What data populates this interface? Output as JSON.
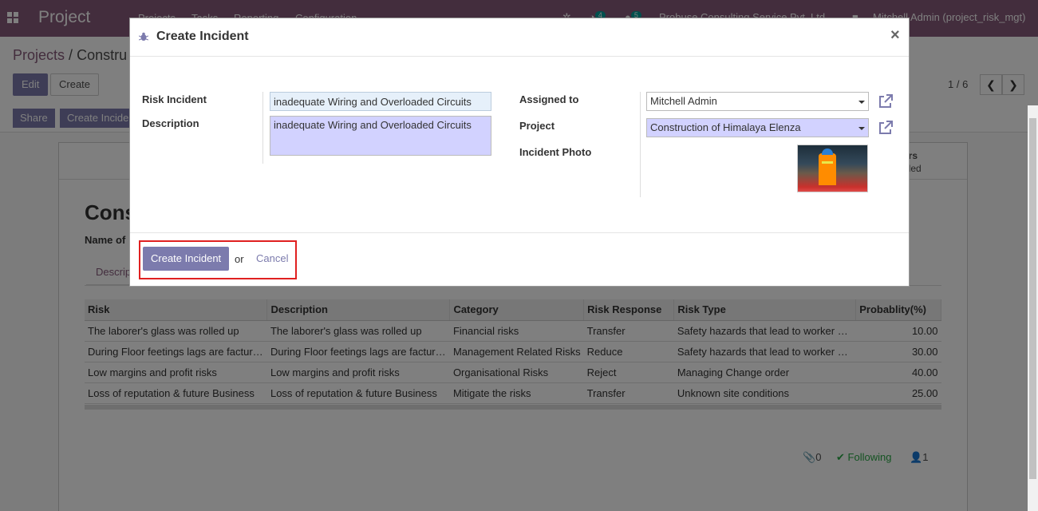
{
  "navbar": {
    "brand": "Project",
    "menu": [
      "Projects",
      "Tasks",
      "Reporting",
      "Configuration"
    ],
    "activity_count": "4",
    "messages_count": "5",
    "company": "Probuse Consulting Service Pvt. Ltd.",
    "user": "Mitchell Admin (project_risk_mgt)"
  },
  "control": {
    "breadcrumb_root": "Projects",
    "breadcrumb_sep": "/",
    "breadcrumb_current": "Constru",
    "edit_label": "Edit",
    "create_label": "Create",
    "pager": "1 / 6",
    "share_label": "Share",
    "create_incident_label": "Create Incide"
  },
  "sheet": {
    "stat_line1": "ours",
    "stat_line2": "orded",
    "title": "Cons",
    "name_label": "Name of",
    "tab_label": "Descrip",
    "columns": [
      "Risk",
      "Description",
      "Category",
      "Risk Response",
      "Risk Type",
      "Probablity(%)"
    ],
    "rows": [
      [
        "The laborer's glass was rolled up",
        "The laborer's glass was rolled up",
        "Financial risks",
        "Transfer",
        "Safety hazards that lead to worker …",
        "10.00"
      ],
      [
        "During Floor feetings lags are factur…",
        "During Floor feetings lags are factur…",
        "Management Related Risks",
        "Reduce",
        "Safety hazards that lead to worker …",
        "30.00"
      ],
      [
        "Low margins and profit risks",
        "Low margins and profit risks",
        "Organisational Risks",
        "Reject",
        "Managing Change order",
        "40.00"
      ],
      [
        "Loss of reputation & future Business",
        "Loss of reputation & future Business",
        "Mitigate the risks",
        "Transfer",
        "Unknown site conditions",
        "25.00"
      ]
    ],
    "attachments": "0",
    "following": "Following",
    "followers": "1"
  },
  "modal": {
    "title": "Create Incident",
    "close": "×",
    "risk_incident_label": "Risk Incident",
    "risk_incident_value": "inadequate Wiring and Overloaded Circuits",
    "description_label": "Description",
    "description_value": "inadequate Wiring and Overloaded Circuits",
    "assigned_to_label": "Assigned to",
    "assigned_to_value": "Mitchell Admin",
    "project_label": "Project",
    "project_value": "Construction of Himalaya Elenza",
    "photo_label": "Incident Photo",
    "create_button": "Create Incident",
    "or": "or",
    "cancel": "Cancel"
  },
  "colors": {
    "navbar": "#875a7b",
    "primary": "#7c7bad",
    "required_field": "#d2d2ff",
    "highlight": "#e02020"
  }
}
